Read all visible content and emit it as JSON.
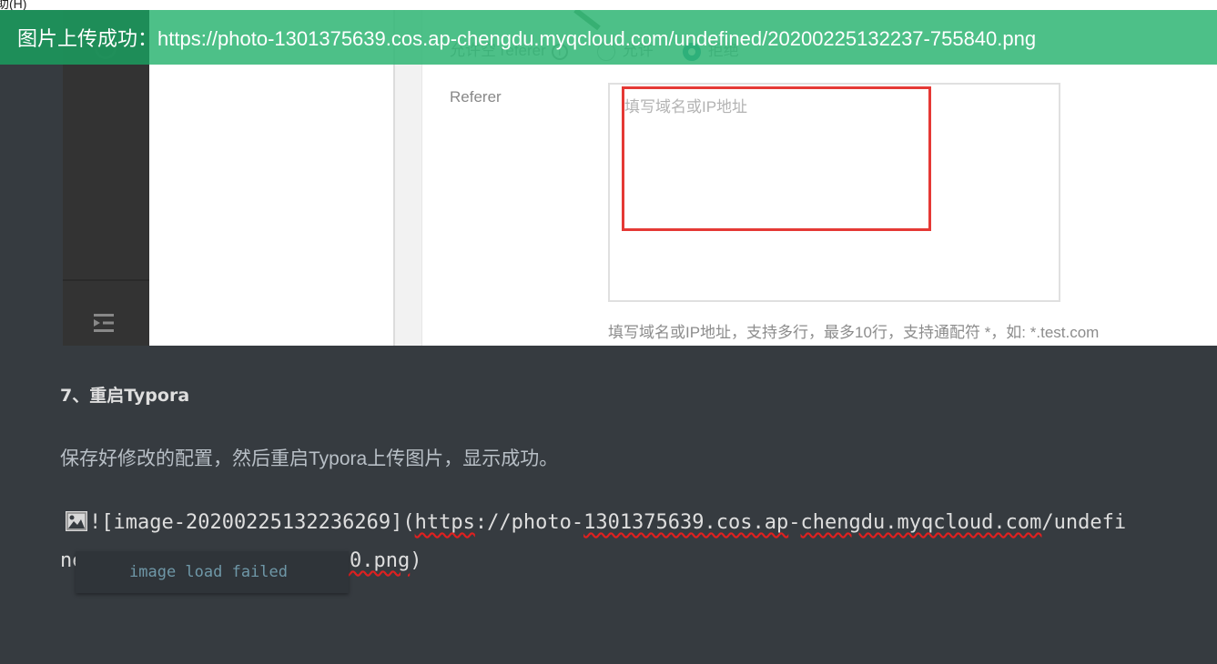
{
  "menu": {
    "help_partial": "助(H)"
  },
  "banner": {
    "text": "图片上传成功：https://photo-1301375639.cos.ap-chengdu.myqcloud.com/undefined/20200225132237-755840.png",
    "bg_color": "#34b778"
  },
  "embedded_screenshot": {
    "sidebar_icon": "outline-toggle-icon",
    "allow_empty_referer": {
      "label": "允许空 referer",
      "options": [
        {
          "label": "允许",
          "selected": false
        },
        {
          "label": "拒绝",
          "selected": true
        }
      ]
    },
    "referer": {
      "label": "Referer",
      "placeholder": "填写域名或IP地址",
      "hint": "填写域名或IP地址，支持多行，最多10行，支持通配符 *，如: *.test.com"
    },
    "highlight_color": "#e53935"
  },
  "editor": {
    "heading": "7、重启Typora",
    "paragraph": "保存好修改的配置，然后重启Typora上传图片，显示成功。",
    "markdown_image": {
      "prefix": "![image-20200225132236269](",
      "url_scheme": "https",
      "url_sep": "://photo-",
      "url_id": "1301375639.cos.ap",
      "url_dash": "-",
      "url_host": "chengdu.myqcloud.com",
      "url_rest_line1": "/undefi",
      "line2_start": "ne",
      "line2_underlined": "840.png",
      "line2_end": ")"
    },
    "tooltip": "image load failed"
  }
}
